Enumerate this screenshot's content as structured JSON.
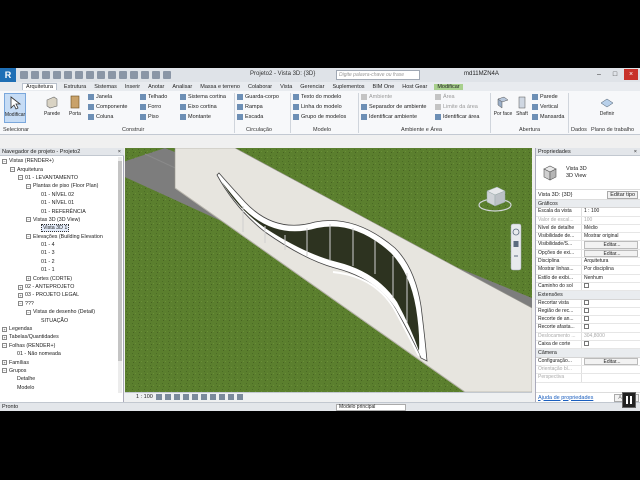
{
  "titlebar": {
    "logo": "R",
    "title": "Projeto2 - Vista 3D: {3D}",
    "search_placeholder": "Digite palavra-chave ou frase",
    "user": "md11MZN4A"
  },
  "tabs": [
    "Arquitetura",
    "Estrutura",
    "Sistemas",
    "Inserir",
    "Anotar",
    "Analisar",
    "Massa e terreno",
    "Colaborar",
    "Vista",
    "Gerenciar",
    "Suplementos",
    "BIM One",
    "Host Gear",
    "Modificar"
  ],
  "ribbon": {
    "selecionar": "Selecionar",
    "modificar": "Modificar",
    "parede": "Parede",
    "porta": "Porta",
    "construir_col1": [
      "Janela",
      "Componente",
      "Coluna"
    ],
    "construir_col2": [
      "Telhado",
      "Forro",
      "Piso"
    ],
    "construir_col3": [
      "Sistema cortina",
      "Eixo cortina",
      "Montante"
    ],
    "circulacao": [
      "Guarda-corpo",
      "Rampa",
      "Escada"
    ],
    "modelo": [
      "Texto do modelo",
      "Linha do modelo",
      "Grupo de modelos"
    ],
    "ambiente": [
      "Ambiente",
      "Separador de ambiente",
      "Identificar ambiente"
    ],
    "area": [
      "Área",
      "Limite da área",
      "Identificar área"
    ],
    "por_face": "Por face",
    "shaft": "Shaft",
    "abertura": [
      "Parede",
      "Vertical",
      "Mansarda"
    ],
    "definir": "Definir",
    "panel_labels": {
      "selecionar": "Selecionar",
      "construir": "Construir",
      "circulacao": "Circulação",
      "modelo": "Modelo",
      "ambiente": "Ambiente e Área",
      "abertura": "Abertura",
      "dados": "Dados",
      "plano": "Plano de trabalho"
    }
  },
  "browser": {
    "title": "Navegador de projeto - Projeto2",
    "close": "×",
    "rows": [
      {
        "indent": 0,
        "toggle": "−",
        "label": "Vistas (RENDER+)"
      },
      {
        "indent": 1,
        "toggle": "−",
        "label": "Arquitetura"
      },
      {
        "indent": 2,
        "toggle": "−",
        "label": "01 - LEVANTAMENTO"
      },
      {
        "indent": 3,
        "toggle": "−",
        "label": "Plantas de piso (Floor Plan)"
      },
      {
        "indent": 4,
        "toggle": "",
        "label": "01 - NÍVEL 02"
      },
      {
        "indent": 4,
        "toggle": "",
        "label": "01 - NÍVEL 01"
      },
      {
        "indent": 4,
        "toggle": "",
        "label": "01 - REFERÊNCIA"
      },
      {
        "indent": 3,
        "toggle": "−",
        "label": "Vistas 3D (3D View)"
      },
      {
        "indent": 4,
        "toggle": "",
        "label": "Vista 3D 1",
        "selected": true
      },
      {
        "indent": 3,
        "toggle": "−",
        "label": "Elevações (Building Elevation"
      },
      {
        "indent": 4,
        "toggle": "",
        "label": "01 - 4"
      },
      {
        "indent": 4,
        "toggle": "",
        "label": "01 - 3"
      },
      {
        "indent": 4,
        "toggle": "",
        "label": "01 - 2"
      },
      {
        "indent": 4,
        "toggle": "",
        "label": "01 - 1"
      },
      {
        "indent": 3,
        "toggle": "+",
        "label": "Cortes (CORTE)"
      },
      {
        "indent": 2,
        "toggle": "+",
        "label": "02 - ANTEPROJETO"
      },
      {
        "indent": 2,
        "toggle": "+",
        "label": "03 - PROJETO LEGAL"
      },
      {
        "indent": 2,
        "toggle": "−",
        "label": "???"
      },
      {
        "indent": 3,
        "toggle": "−",
        "label": "Vistas de desenho (Detail)"
      },
      {
        "indent": 4,
        "toggle": "",
        "label": "SITUAÇÃO"
      },
      {
        "indent": 0,
        "toggle": "+",
        "label": "Legendas"
      },
      {
        "indent": 0,
        "toggle": "+",
        "label": "Tabelas/Quantidades"
      },
      {
        "indent": 0,
        "toggle": "−",
        "label": "Folhas (RENDER+)"
      },
      {
        "indent": 1,
        "toggle": "",
        "label": "01 - Não nomeada"
      },
      {
        "indent": 0,
        "toggle": "+",
        "label": "Famílias"
      },
      {
        "indent": 0,
        "toggle": "−",
        "label": "Grupos"
      },
      {
        "indent": 1,
        "toggle": "",
        "label": "Detalhe"
      },
      {
        "indent": 1,
        "toggle": "",
        "label": "Modelo"
      }
    ]
  },
  "viewbar": {
    "scale": "1 : 100"
  },
  "properties": {
    "title": "Propriedades",
    "close": "×",
    "type_name": "Vista 3D",
    "type_sub": "3D View",
    "type_row": "Vista 3D: {3D}",
    "edit_type": "Editar tipo",
    "sections": [
      {
        "name": "Gráficos",
        "rows": [
          {
            "k": "Escala da vista",
            "v": "1 : 100"
          },
          {
            "k": "Valor de escal...",
            "v": "100",
            "grey": true
          },
          {
            "k": "Nível de detalhe",
            "v": "Médio"
          },
          {
            "k": "Visibilidade de...",
            "v": "Mostrar original"
          },
          {
            "k": "Visibilidade/S...",
            "v": "Editar...",
            "btn": true
          },
          {
            "k": "Opções de exi...",
            "v": "Editar...",
            "btn": true
          },
          {
            "k": "Disciplina",
            "v": "Arquitetura"
          },
          {
            "k": "Mostrar linhas...",
            "v": "Por disciplina"
          },
          {
            "k": "Estilo de exibi...",
            "v": "Nenhum"
          },
          {
            "k": "Caminho do sol",
            "v": "",
            "cb": true
          }
        ]
      },
      {
        "name": "Extensões",
        "rows": [
          {
            "k": "Recortar vista",
            "v": "",
            "cb": true
          },
          {
            "k": "Região de rec...",
            "v": "",
            "cb": true
          },
          {
            "k": "Recorte de an...",
            "v": "",
            "cb": true
          },
          {
            "k": "Recorte afasta...",
            "v": "",
            "cb": true
          },
          {
            "k": "Deslocamento ...",
            "v": "304,8000",
            "grey": true
          },
          {
            "k": "Caixa de corte",
            "v": "",
            "cb": true
          }
        ]
      },
      {
        "name": "Câmera",
        "rows": [
          {
            "k": "Configuração...",
            "v": "Editar...",
            "btn": true
          },
          {
            "k": "Orientação bl...",
            "v": "",
            "grey": true
          },
          {
            "k": "Perspectiva",
            "v": "",
            "grey": true
          }
        ]
      }
    ],
    "help_link": "Ajuda de propriedades",
    "apply": "Aplicar"
  },
  "status": {
    "left": "Pronto",
    "model": "Modelo principal"
  },
  "colors": {
    "grass": "#5b7f2e",
    "road": "#7d7d7d",
    "wall": "#e7e5df",
    "glass": "#2d3320",
    "ribbon_sel": "#c6dcf5"
  }
}
